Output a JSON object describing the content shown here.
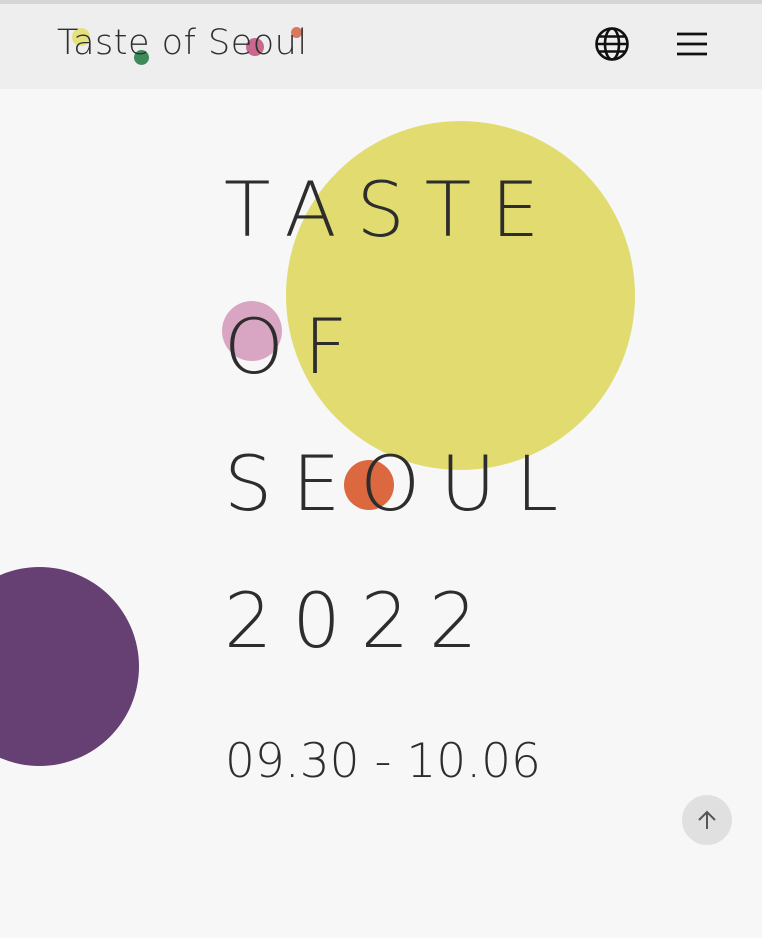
{
  "header": {
    "logo_text": "Taste of Seoul",
    "language_icon": "globe-icon",
    "menu_icon": "hamburger-menu-icon"
  },
  "hero": {
    "title_lines": [
      "TASTE",
      "OF",
      "SEOUL",
      "2022"
    ],
    "date_range": "09.30 - 10.06"
  },
  "scroll_top_icon": "arrow-up-icon",
  "colors": {
    "header_bg": "#eeeeee",
    "page_bg": "#f7f7f7",
    "text": "#2d2d2d",
    "yellow": "#e2dc70",
    "pink": "#d8a6c3",
    "orange": "#db683e",
    "purple": "#663f73",
    "green": "#3f8a5a"
  }
}
